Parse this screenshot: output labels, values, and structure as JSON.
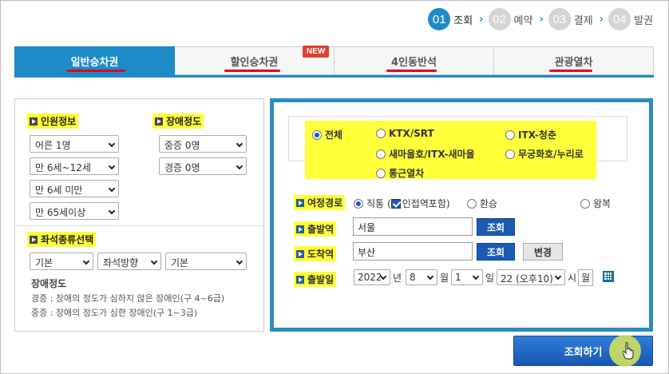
{
  "steps": [
    {
      "num": "01",
      "label": "조회"
    },
    {
      "num": "02",
      "label": "예약"
    },
    {
      "num": "03",
      "label": "결제"
    },
    {
      "num": "04",
      "label": "발권"
    }
  ],
  "tabs": [
    {
      "label": "일반승차권"
    },
    {
      "label": "할인승차권",
      "badge": "NEW"
    },
    {
      "label": "4인동반석"
    },
    {
      "label": "관광열차"
    }
  ],
  "passengers": {
    "title": "인원정보",
    "adult": "어른 1명",
    "child": "만 6세~12세",
    "infant": "만 6세 미만",
    "senior": "만 65세이상"
  },
  "disability": {
    "title": "장애정도",
    "severe": "중증 0명",
    "mild": "경증 0명"
  },
  "seat": {
    "title": "좌석종류선택",
    "type": "기본",
    "direction": "좌석방향",
    "position": "기본"
  },
  "disability_info": {
    "title": "장애정도",
    "mild_desc": "경증 : 장애의 정도가 심하지 않은 장애인(구 4~6급)",
    "severe_desc": "중증 : 장애의 정도가 심한 장애인(구 1~3급)"
  },
  "train_types": {
    "all": "전체",
    "ktx": "KTX/SRT",
    "itx_cheongchun": "ITX-청춘",
    "saemaeul": "새마을호/ITX-새마을",
    "mugunghwa": "무궁화호/누리로",
    "commuter": "통근열차"
  },
  "route": {
    "label": "여정경로",
    "direct": "직통",
    "paren_open": "(",
    "include_adjacent": "인접역포함)",
    "transfer": "환승",
    "roundtrip": "왕복"
  },
  "departure": {
    "label": "출발역",
    "value": "서울",
    "search": "조회"
  },
  "arrival": {
    "label": "도착역",
    "value": "부산",
    "search": "조회",
    "swap": "변경"
  },
  "date": {
    "label": "출발일",
    "year": "2022",
    "year_unit": "년",
    "month": "8",
    "month_unit": "월",
    "day": "1",
    "day_unit": "일",
    "hour": "22 (오후10)",
    "hour_unit": "시",
    "weekday": "월"
  },
  "search_button": "조회하기"
}
